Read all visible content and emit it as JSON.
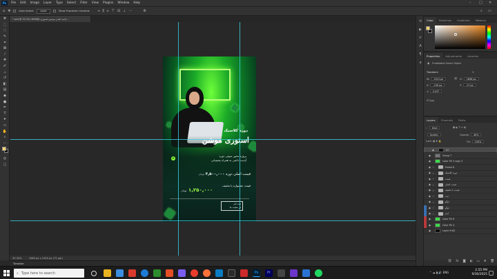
{
  "menu": {
    "logo": "Ps",
    "items": [
      "File",
      "Edit",
      "Image",
      "Layer",
      "Type",
      "Select",
      "Filter",
      "View",
      "Plugins",
      "Window",
      "Help"
    ]
  },
  "options": {
    "auto_select_label": "Auto-Select:",
    "auto_select_value": "Layer",
    "transform_label": "Show Transform Controls"
  },
  "document": {
    "tab_title": "…احمد امانی-موشن-استوری.psd @ 33.3% (RGB/8) *"
  },
  "poster": {
    "title_small": "دوره کلاسیک",
    "title_big": "استوری موشن",
    "desc1": "پروژه محور سوئی دوره",
    "desc2": "آپدیت دائمی به همراه پشتیبانی",
    "price_label": "قیمت اصلی دوره",
    "price_value": "۳,۵۰۰,۰۰۰",
    "price_unit": "تومان",
    "discount_label": "قیمت جشنواره با تخفیف",
    "discount_value": "۱,۲۵۰,۰۰۰",
    "discount_unit": "تومان",
    "box_line1": "ثبت نام",
    "box_line2": "در سایت ما"
  },
  "status": {
    "zoom": "33.33%",
    "size": "1080 px x 1920 px (72 ppi)"
  },
  "timeline": {
    "label": "Timeline"
  },
  "color_panel": {
    "tabs": [
      "Color",
      "Swatches",
      "Gradients",
      "Patterns"
    ],
    "active_tab": "Color",
    "picker_hue": "#e8841c"
  },
  "properties": {
    "tabs": [
      "Properties",
      "Adjustments",
      "Libraries"
    ],
    "header": "Embedded Smart Object",
    "transform_label": "Transform",
    "w_label": "W:",
    "w_value": "1013 px",
    "h_label": "H:",
    "h_value": "1898 px",
    "x_label": "X:",
    "x_value": "-139 px",
    "y_label": "Y:",
    "y_value": "-17 px",
    "angle_value": "0.00°",
    "filename": "07.jpg"
  },
  "layers": {
    "tabs": [
      "Layers",
      "Channels",
      "Paths"
    ],
    "kind_label": "Kind",
    "blend_mode": "Screen",
    "opacity_label": "Opacity:",
    "opacity_value": "40%",
    "fill_label": "Fill:",
    "fill_value": "100%",
    "rows": [
      {
        "name": "07",
        "type": "smart",
        "color": "",
        "thumb": "#111"
      },
      {
        "name": "Group 7",
        "type": "layer",
        "color": "",
        "thumb": "#777"
      },
      {
        "name": "Color Fill 5 copy 3",
        "type": "fill",
        "color": "",
        "thumb": "#3ed94a"
      },
      {
        "name": "Frame 8",
        "type": "folder",
        "color": ""
      },
      {
        "name": "دوره کلاسیک",
        "type": "folder",
        "color": ""
      },
      {
        "name": "قیمت",
        "type": "folder",
        "color": ""
      },
      {
        "name": "قیمت اصلی",
        "type": "folder",
        "color": ""
      },
      {
        "name": "قیمت با تخفیف",
        "type": "folder",
        "color": ""
      },
      {
        "name": "ثبت",
        "type": "folder",
        "color": ""
      },
      {
        "name": "لوگو",
        "type": "folder",
        "color": ""
      },
      {
        "name": "لوگو",
        "type": "folder",
        "color": "#3a6fb0"
      },
      {
        "name": "آیتم",
        "type": "folder",
        "color": "#3a6fb0"
      },
      {
        "name": "Color Fill 6",
        "type": "fill",
        "color": "#b83a3a",
        "thumb": "#3ed94a"
      },
      {
        "name": "Color Fill 4",
        "type": "fill",
        "color": "#b83a3a",
        "thumb": "#3ed94a"
      },
      {
        "name": "Layer 9 BG",
        "type": "layer",
        "color": "",
        "thumb": "#101010"
      }
    ]
  },
  "taskbar": {
    "search_placeholder": "Type here to search",
    "time": "2:55 PM",
    "date": "9/30/2025"
  }
}
